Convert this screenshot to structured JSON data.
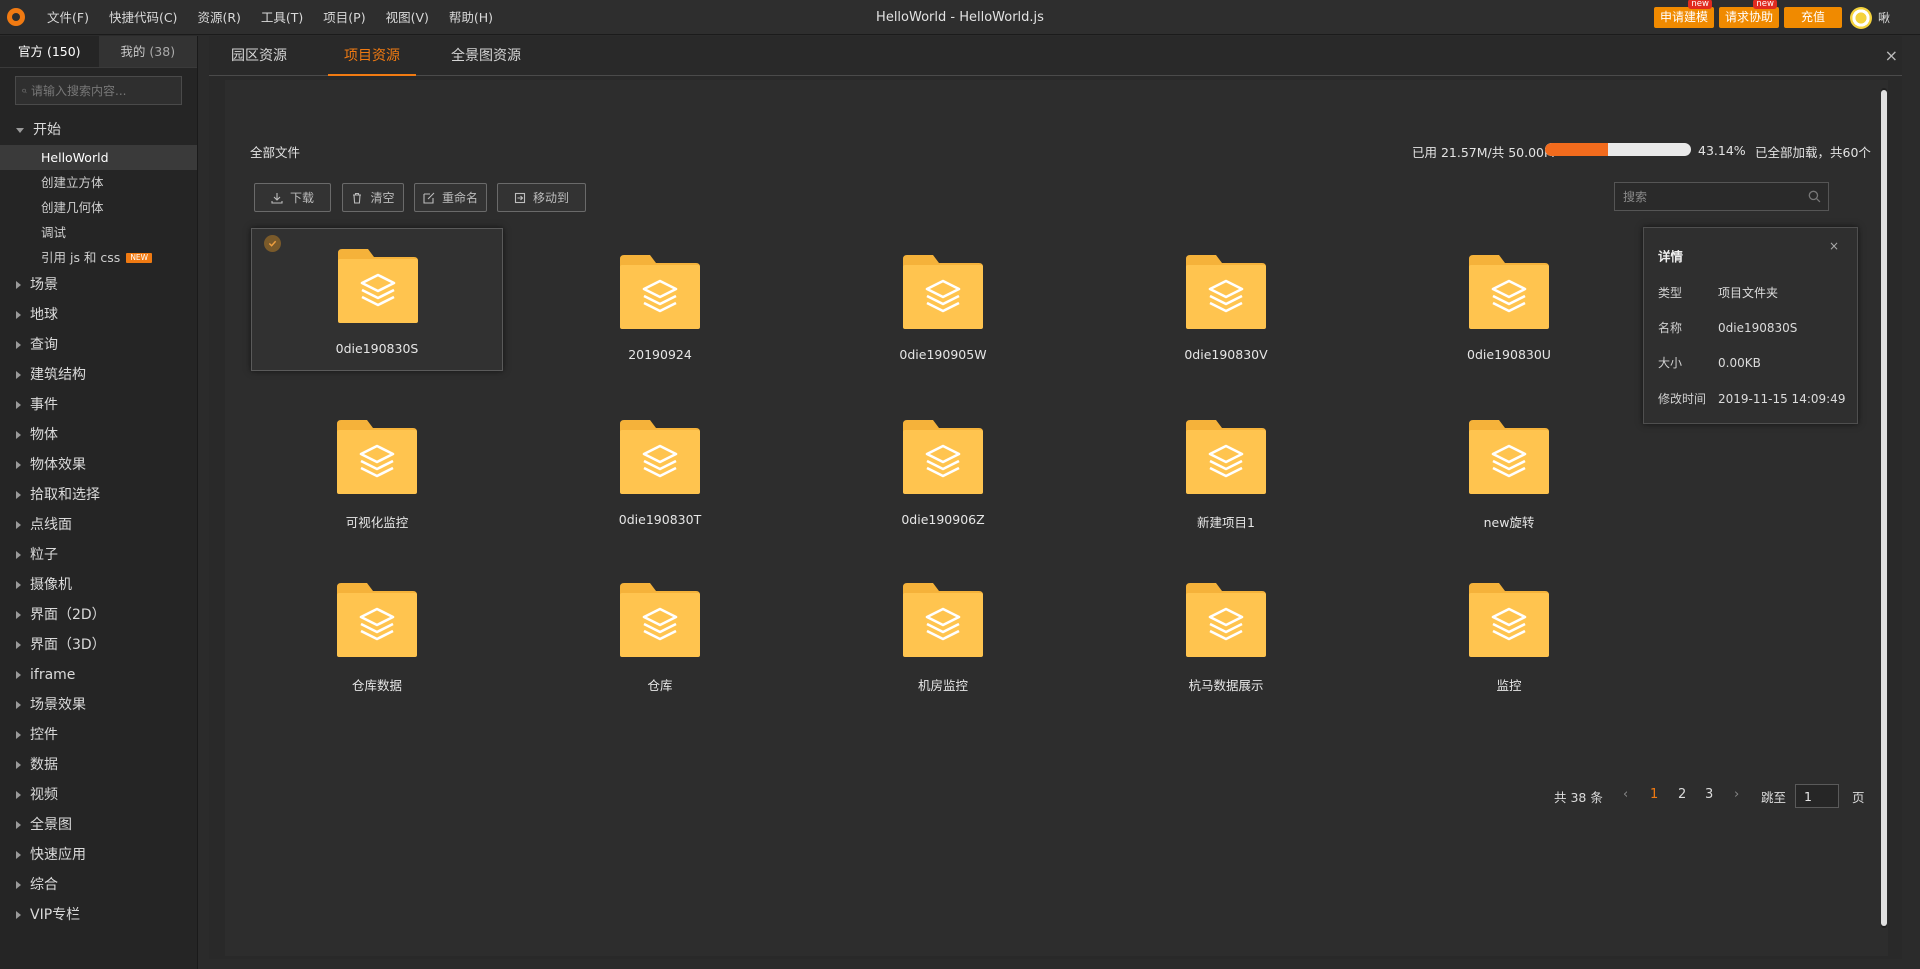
{
  "titlebar": {
    "menu": [
      "文件(F)",
      "快捷代码(C)",
      "资源(R)",
      "工具(T)",
      "项目(P)",
      "视图(V)",
      "帮助(H)"
    ],
    "title": "HelloWorld -  HelloWorld.js",
    "apply_model": "申请建模",
    "request_help": "请求协助",
    "new_tag": "new",
    "recharge": "充值",
    "user": "啾"
  },
  "sidebar": {
    "tab_official": "官方",
    "tab_official_count": "(150)",
    "tab_mine": "我的",
    "tab_mine_count": "(38)",
    "search_placeholder": "请输入搜索内容...",
    "start_label": "开始",
    "sub_items": [
      "HelloWorld",
      "创建立方体",
      "创建几何体",
      "调试",
      "引用 js 和 css"
    ],
    "new_badge": "NEW",
    "categories": [
      "场景",
      "地球",
      "查询",
      "建筑结构",
      "事件",
      "物体",
      "物体效果",
      "拾取和选择",
      "点线面",
      "粒子",
      "摄像机",
      "界面（2D）",
      "界面（3D）",
      "iframe",
      "场景效果",
      "控件",
      "数据",
      "视频",
      "全景图",
      "快速应用",
      "综合",
      "VIP专栏"
    ]
  },
  "tabs": [
    "园区资源",
    "项目资源",
    "全景图资源"
  ],
  "close": "×",
  "content": {
    "breadcrumb": "全部文件",
    "usage": "已用 21.57M/共 50.00M",
    "usage_percent_value": 43.14,
    "usage_percent": "43.14%",
    "loaded": "已全部加载，共60个",
    "buttons": {
      "download": "下载",
      "clear": "清空",
      "rename": "重命名",
      "move": "移动到"
    },
    "search_placeholder": "搜索"
  },
  "files": [
    "0die190830S",
    "20190924",
    "0die190905W",
    "0die190830V",
    "0die190830U",
    "可视化监控",
    "0die190830T",
    "0die190906Z",
    "新建项目1",
    "new旋转",
    "仓库数据",
    "仓库",
    "机房监控",
    "杭马数据展示",
    "监控"
  ],
  "detail": {
    "title": "详情",
    "close": "×",
    "rows": [
      {
        "k": "类型",
        "v": "项目文件夹"
      },
      {
        "k": "名称",
        "v": "0die190830S"
      },
      {
        "k": "大小",
        "v": "0.00KB"
      },
      {
        "k": "修改时间",
        "v": "2019-11-15 14:09:49"
      }
    ]
  },
  "pager": {
    "total": "共 38 条",
    "prev": "‹",
    "pages": [
      "1",
      "2",
      "3"
    ],
    "next": "›",
    "jump": "跳至",
    "jump_value": "1",
    "page_unit": "页"
  },
  "colors": {
    "accent": "#f07a12",
    "folder": "#ffc44f",
    "folder_tab": "#f5b23a"
  }
}
